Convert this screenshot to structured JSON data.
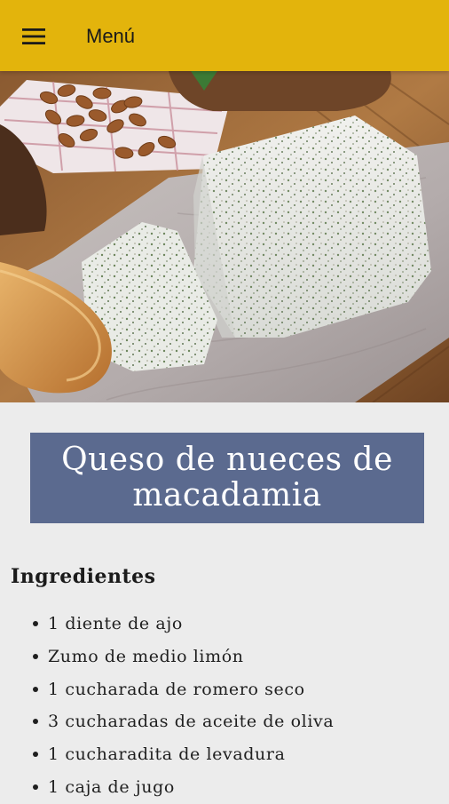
{
  "appbar": {
    "title": "Menú",
    "menu_icon": "hamburger-menu-icon",
    "background": "#e3b40c"
  },
  "hero": {
    "image": "recipe-photo-macadamia-cheese"
  },
  "recipe": {
    "title_line1": "Queso de nueces de",
    "title_line2": "macadamia",
    "title_background": "#5b6a8f"
  },
  "ingredients": {
    "heading": "Ingredientes",
    "items": [
      "1 diente de ajo",
      "Zumo de medio limón",
      "1 cucharada de romero seco",
      "3 cucharadas de aceite de oliva",
      "1 cucharadita de levadura",
      "1 caja de jugo"
    ]
  }
}
